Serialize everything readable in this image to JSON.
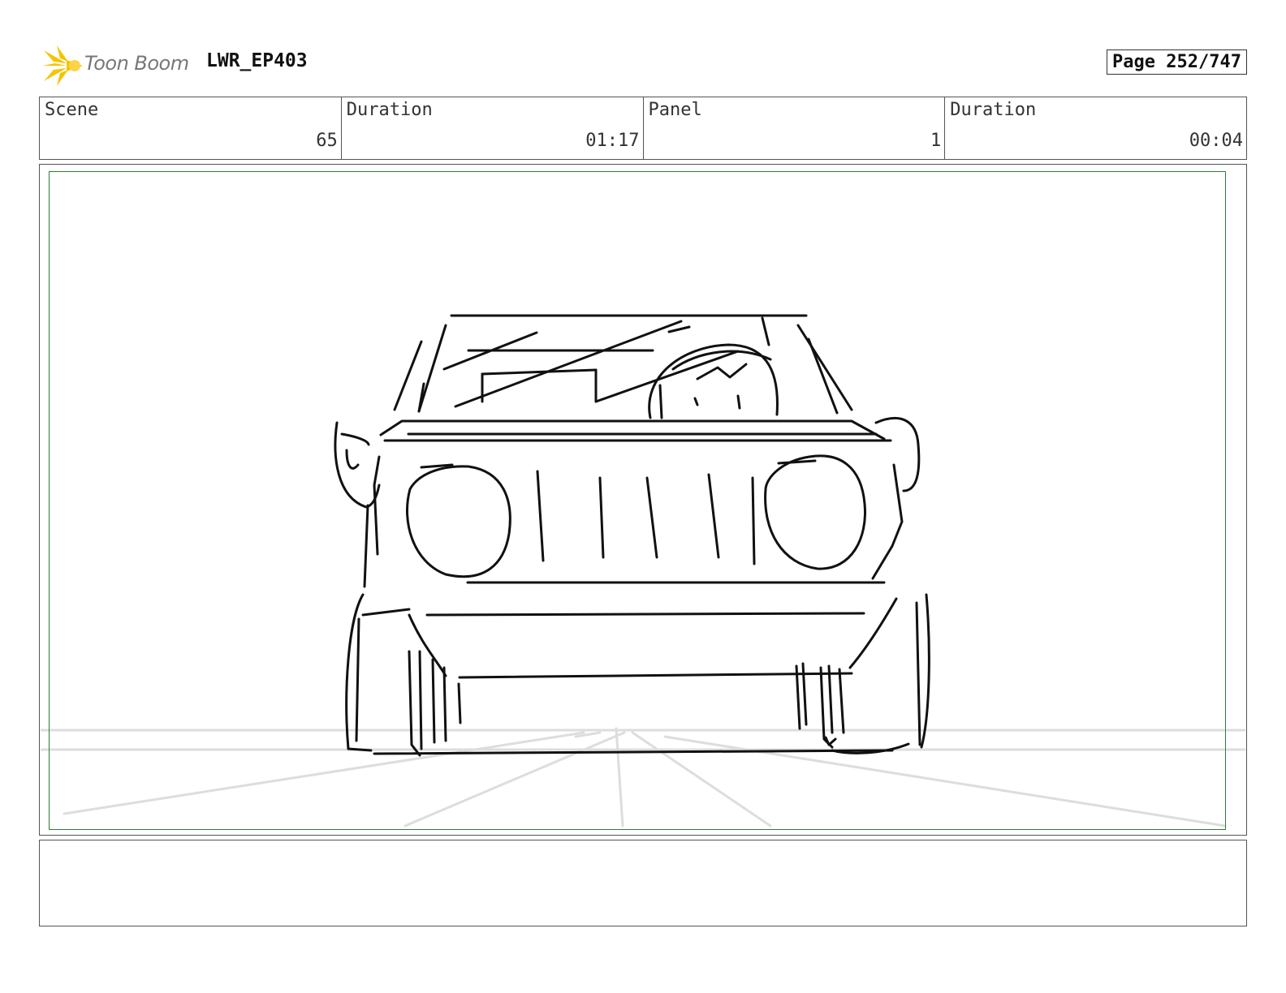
{
  "header": {
    "logo_text": "Toon Boom",
    "project": "LWR_EP403",
    "page": "Page 252/747"
  },
  "info": {
    "scene_label": "Scene",
    "scene_value": "65",
    "scene_duration_label": "Duration",
    "scene_duration_value": "01:17",
    "panel_label": "Panel",
    "panel_value": "1",
    "panel_duration_label": "Duration",
    "panel_duration_value": "00:04"
  },
  "colors": {
    "frame_border": "#2e7d32",
    "logo_accent": "#f5c400",
    "sketch_line": "#111111",
    "guide_line": "#dddddd"
  }
}
